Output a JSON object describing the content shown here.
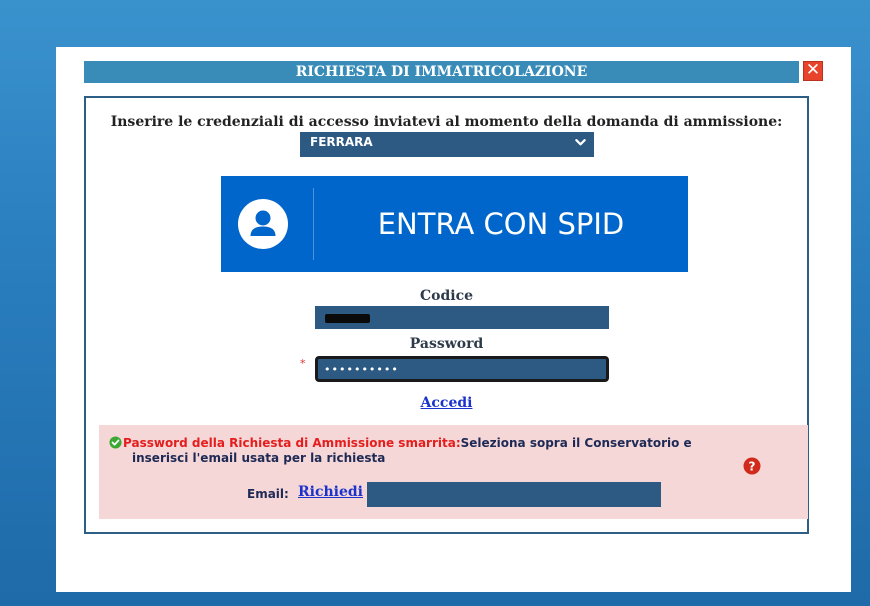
{
  "dialog": {
    "title": "RICHIESTA DI IMMATRICOLAZIONE",
    "close_icon": "close-icon"
  },
  "form": {
    "instructions": "Inserire le credenziali di accesso inviatevi al momento della domanda di ammissione:",
    "conservatorio_select": {
      "selected": "FERRARA"
    },
    "spid_button": {
      "label": "ENTRA CON SPID",
      "icon": "user-avatar-icon"
    },
    "codice": {
      "label": "Codice",
      "value": ""
    },
    "password": {
      "label": "Password",
      "value": "••••••••••",
      "required_marker": "*"
    },
    "submit_link": "Accedi"
  },
  "lost_password": {
    "title": "Password della Richiesta di Ammissione smarrita:",
    "text_line1": "Seleziona sopra il Conservatorio e",
    "text_line2": "inserisci l'email usata per la richiesta",
    "email_label": "Email:",
    "request_link": "Richiedi",
    "email_value": "",
    "icons": {
      "status": "check-circle-icon",
      "help": "help-icon"
    }
  },
  "colors": {
    "title_bar": "#3a8cb8",
    "field_bg": "#2d5a82",
    "spid_blue": "#0066cc",
    "panel_bg": "#f5d7d7",
    "link": "#1a33cc",
    "alert_red": "#e41e1e"
  }
}
